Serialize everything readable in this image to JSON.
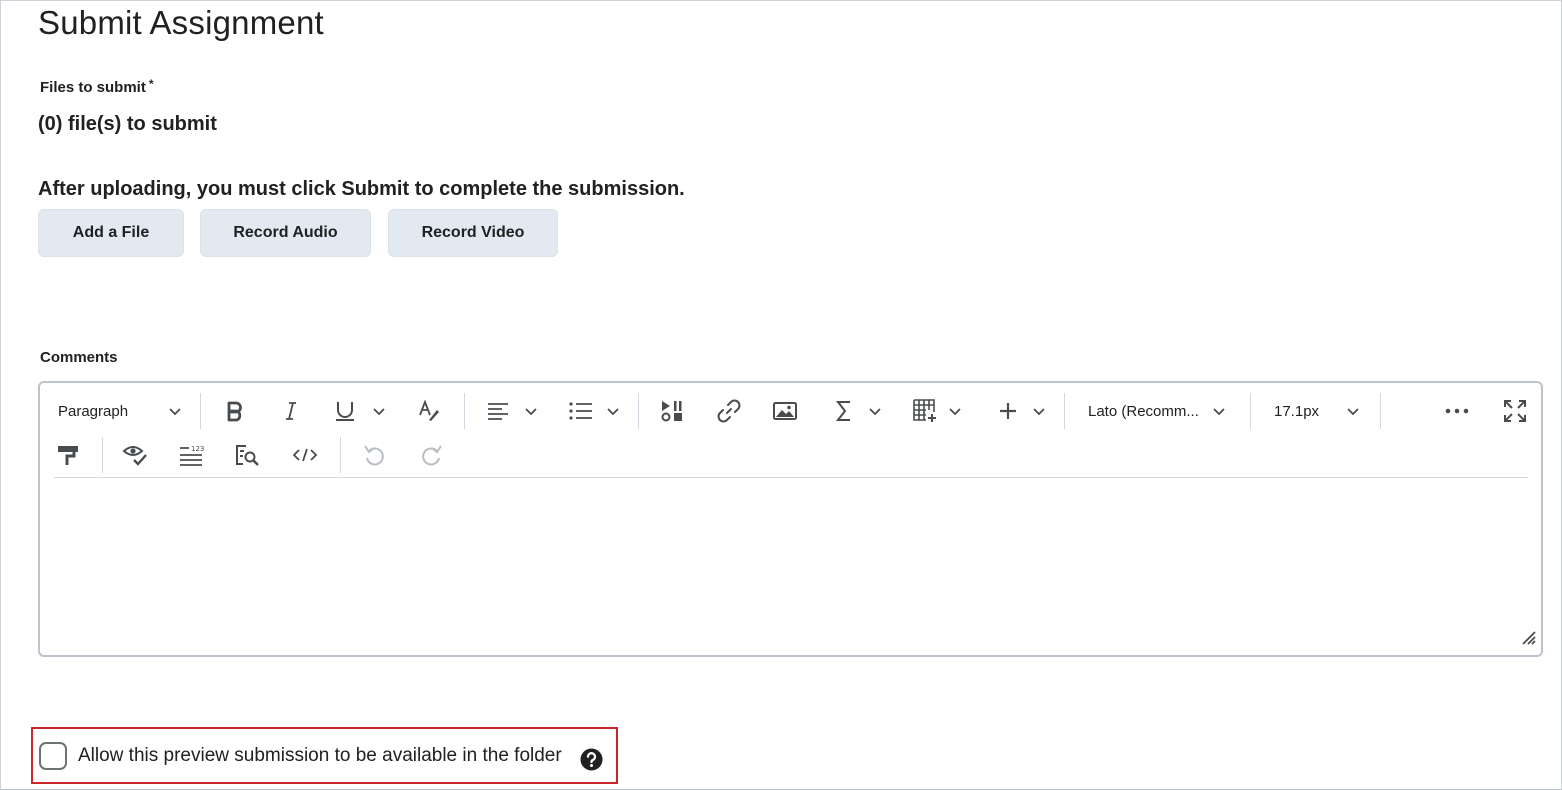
{
  "page": {
    "title": "Submit Assignment"
  },
  "files": {
    "label": "Files to submit",
    "required_marker": "*",
    "count_text": "(0) file(s) to submit"
  },
  "notice": "After uploading, you must click Submit to complete the submission.",
  "buttons": {
    "add_file": "Add a File",
    "record_audio": "Record Audio",
    "record_video": "Record Video"
  },
  "comments": {
    "label": "Comments",
    "toolbar": {
      "block_format": "Paragraph",
      "font_family": "Lato (Recomm...",
      "font_size": "17.1px",
      "icons": [
        "chevron-down-icon",
        "bold-icon",
        "italic-icon",
        "underline-icon",
        "format-clear-icon",
        "align-left-icon",
        "bulleted-list-icon",
        "media-icon",
        "link-icon",
        "image-icon",
        "sigma-icon",
        "table-icon",
        "plus-icon",
        "more-icon",
        "fullscreen-icon",
        "paint-format-icon",
        "accessibility-check-icon",
        "word-count-icon",
        "find-replace-icon",
        "source-code-icon",
        "undo-icon",
        "redo-icon",
        "resize-handle-icon"
      ]
    }
  },
  "preview": {
    "checkbox_label": "Allow this preview submission to be available in the folder",
    "checked": false
  },
  "colors": {
    "button_bg": "#e3e9f1",
    "highlight_border": "#c9272b",
    "text": "#202122",
    "icon": "#494c4e"
  }
}
